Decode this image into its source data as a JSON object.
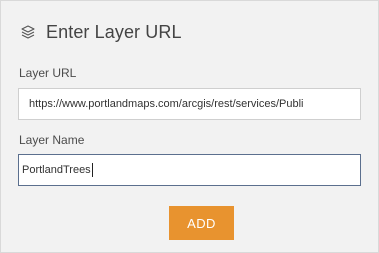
{
  "header": {
    "icon": "layers-icon",
    "title": "Enter Layer URL"
  },
  "fields": {
    "url": {
      "label": "Layer URL",
      "value": "https://www.portlandmaps.com/arcgis/rest/services/Publi"
    },
    "name": {
      "label": "Layer Name",
      "value": "PortlandTrees"
    }
  },
  "actions": {
    "add_label": "ADD"
  },
  "colors": {
    "panel_bg": "#f2f2f2",
    "accent": "#e8932f",
    "focus_border": "#5b6f8e"
  }
}
